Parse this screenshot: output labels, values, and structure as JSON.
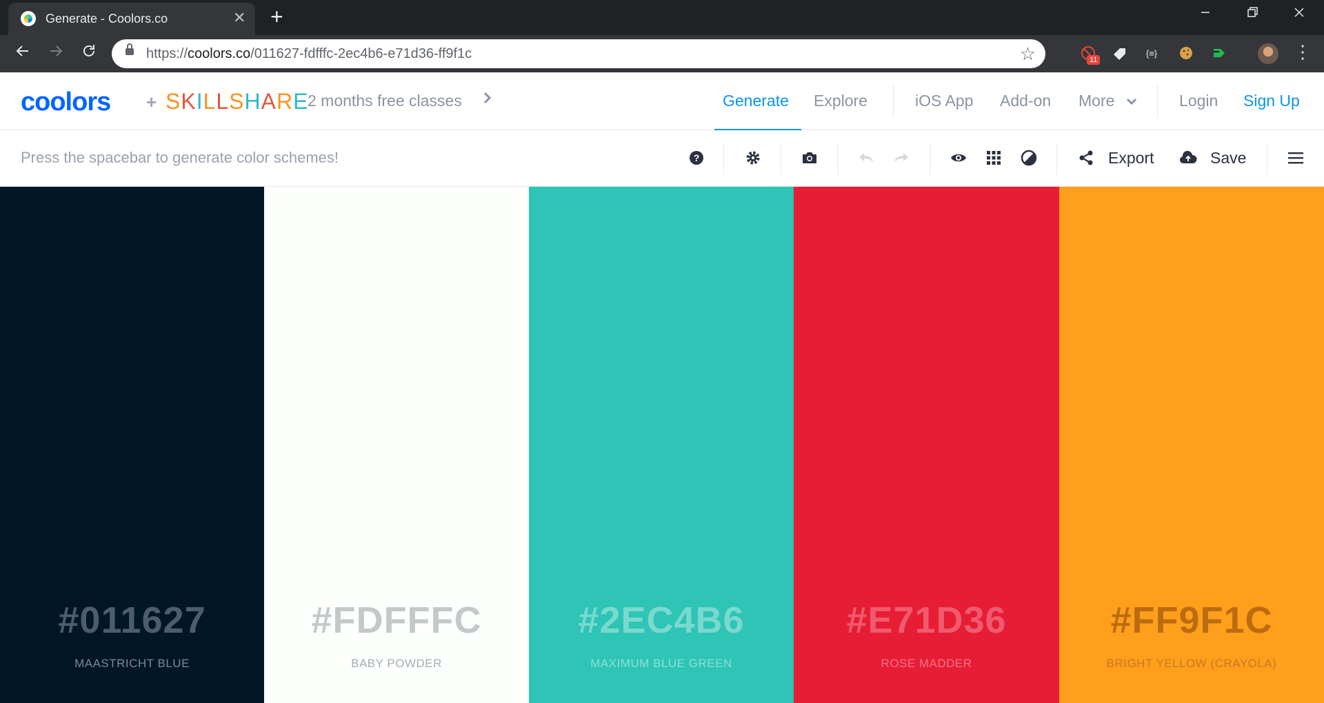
{
  "browser": {
    "tab_title": "Generate - Coolors.co",
    "tab_close": "✕",
    "new_tab": "+",
    "url_scheme": "https://",
    "url_host": "coolors.co",
    "url_path": "/011627-fdfffc-2ec4b6-e71d36-ff9f1c",
    "ext_badge": "11",
    "ext_json": "{≡}",
    "icons": [
      "back-arrow-icon",
      "forward-arrow-icon",
      "reload-icon",
      "lock-icon",
      "star-icon",
      "minimize-icon",
      "restore-icon",
      "close-icon",
      "kebab-menu-icon"
    ]
  },
  "header": {
    "logo": "coolors",
    "plus": "+",
    "skillshare_letters": [
      {
        "ch": "S",
        "color": "#f7931e"
      },
      {
        "ch": "K",
        "color": "#e8533f"
      },
      {
        "ch": "I",
        "color": "#2eb8c9"
      },
      {
        "ch": "L",
        "color": "#f7931e"
      },
      {
        "ch": "L",
        "color": "#e8533f"
      },
      {
        "ch": "S",
        "color": "#f7931e"
      },
      {
        "ch": "H",
        "color": "#2eb8c9"
      },
      {
        "ch": "A",
        "color": "#e8533f"
      },
      {
        "ch": "R",
        "color": "#f7931e"
      },
      {
        "ch": "E",
        "color": "#2eb8c9"
      }
    ],
    "promo": "2 months free classes",
    "nav": {
      "generate": "Generate",
      "explore": "Explore",
      "ios_app": "iOS App",
      "addon": "Add-on",
      "more": "More",
      "login": "Login",
      "signup": "Sign Up"
    }
  },
  "toolbar": {
    "hint": "Press the spacebar to generate color schemes!",
    "export_label": "Export",
    "save_label": "Save"
  },
  "palette": [
    {
      "hex": "#011627",
      "name": "MAASTRICHT BLUE",
      "bg": "#011627",
      "hex_color": "#4e5d6c",
      "name_color": "#7d8996"
    },
    {
      "hex": "#FDFFFC",
      "name": "BABY POWDER",
      "bg": "#fdfffc",
      "hex_color": "#c5c8c9",
      "name_color": "#a6abae"
    },
    {
      "hex": "#2EC4B6",
      "name": "MAXIMUM BLUE GREEN",
      "bg": "#2ec4b6",
      "hex_color": "#7ad9cf",
      "name_color": "#8fe0d6"
    },
    {
      "hex": "#E71D36",
      "name": "ROSE MADDER",
      "bg": "#e71d36",
      "hex_color": "#f05a6e",
      "name_color": "#f27585"
    },
    {
      "hex": "#FF9F1C",
      "name": "BRIGHT YELLOW (CRAYOLA)",
      "bg": "#ff9f1c",
      "hex_color": "#bb6c10",
      "name_color": "#c47a22"
    }
  ]
}
